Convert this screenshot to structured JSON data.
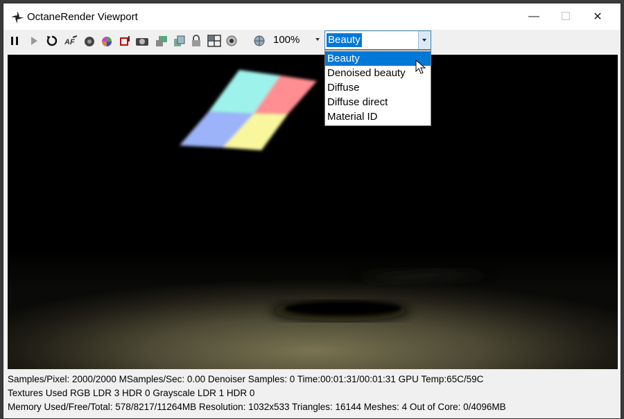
{
  "window": {
    "title": "OctaneRender Viewport"
  },
  "window_controls": {
    "minimize": "—",
    "maximize": "☐",
    "close": "✕"
  },
  "toolbar": {
    "icons": [
      "pause-icon",
      "play-icon",
      "restart-icon",
      "autofocus-icon",
      "camera-target-icon",
      "color-picker-icon",
      "region-render-icon",
      "snapshot-icon",
      "save-icon",
      "layers-icon",
      "lock-icon",
      "grid-view-icon",
      "eye-icon",
      "network-icon"
    ],
    "zoom": "100%"
  },
  "render_pass": {
    "selected": "Beauty",
    "options": [
      "Beauty",
      "Denoised beauty",
      "Diffuse",
      "Diffuse direct",
      "Material ID"
    ]
  },
  "status": {
    "line1": "Samples/Pixel: 2000/2000  MSamples/Sec: 0.00  Denoiser Samples: 0  Time:00:01:31/00:01:31  GPU Temp:65C/59C",
    "line2": "Textures Used RGB LDR 3  HDR 0  Grayscale LDR 1  HDR 0",
    "line3": "Memory Used/Free/Total: 578/8217/11264MB  Resolution: 1032x533  Triangles: 16144  Meshes: 4 Out of Core: 0/4096MB"
  },
  "colors": {
    "accent": "#0078d7",
    "viewport_bg": "#000000"
  }
}
